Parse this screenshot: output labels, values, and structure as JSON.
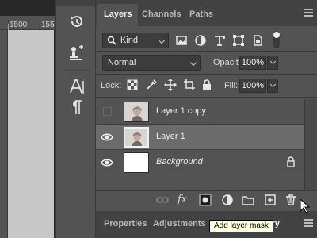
{
  "ruler": {
    "marks": [
      "1500",
      "155"
    ]
  },
  "panel": {
    "tabs": [
      {
        "label": "Layers",
        "active": true
      },
      {
        "label": "Channels",
        "active": false
      },
      {
        "label": "Paths",
        "active": false
      }
    ],
    "filter": {
      "kind_label": "Kind"
    },
    "blend": {
      "mode": "Normal",
      "opacity_label": "Opacity:",
      "opacity_value": "100%"
    },
    "lock": {
      "lock_label": "Lock:",
      "fill_label": "Fill:",
      "fill_value": "100%"
    },
    "layers": [
      {
        "name": "Layer 1 copy",
        "visible": false,
        "selected": false,
        "italic": false,
        "locked": false
      },
      {
        "name": "Layer 1",
        "visible": true,
        "selected": true,
        "italic": false,
        "locked": false
      },
      {
        "name": "Background",
        "visible": true,
        "selected": false,
        "italic": true,
        "locked": true
      }
    ],
    "bottom_bar_icons": [
      "link-layers-icon",
      "fx-icon",
      "add-layer-mask-icon",
      "adjustment-layer-icon",
      "new-group-icon",
      "new-layer-icon",
      "delete-layer-icon"
    ],
    "fx_label": "fx",
    "tooltip": "Add layer mask"
  },
  "bottom_tabs": [
    {
      "label": "Properties",
      "active": false
    },
    {
      "label": "Adjustments",
      "active": false
    },
    {
      "label": "History",
      "active": true
    }
  ],
  "colors": {
    "panel_bg": "#535353",
    "tab_bar_bg": "#424242",
    "selected_layer_bg": "#6b6b6b",
    "tooltip_bg": "#ffffe1"
  }
}
